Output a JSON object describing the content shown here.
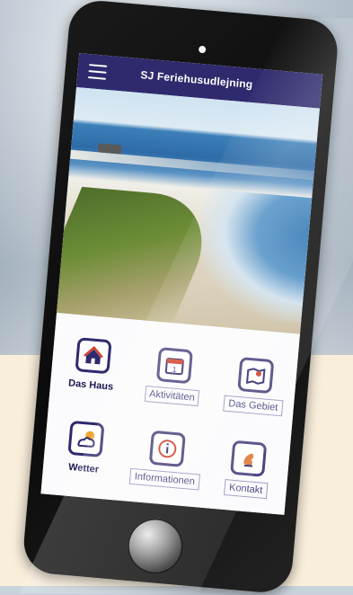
{
  "app": {
    "title": "SJ Feriehusudlejning"
  },
  "icons": {
    "menu": "hamburger-menu-icon",
    "home_button": "home-button-circle"
  },
  "colors": {
    "appbar": "#2f2a6d",
    "accent": "#2f2a6d",
    "phone_frame": "#111111",
    "background_cream": "#f9eedb"
  },
  "tiles": [
    {
      "label": "Das Haus",
      "icon": "house-icon"
    },
    {
      "label": "Aktivitäten",
      "icon": "calendar-icon"
    },
    {
      "label": "Das Gebiet",
      "icon": "map-pin-icon"
    },
    {
      "label": "Wetter",
      "icon": "weather-sun-cloud-icon"
    },
    {
      "label": "Informationen",
      "icon": "info-icon"
    },
    {
      "label": "Kontakt",
      "icon": "contact-icon"
    }
  ]
}
